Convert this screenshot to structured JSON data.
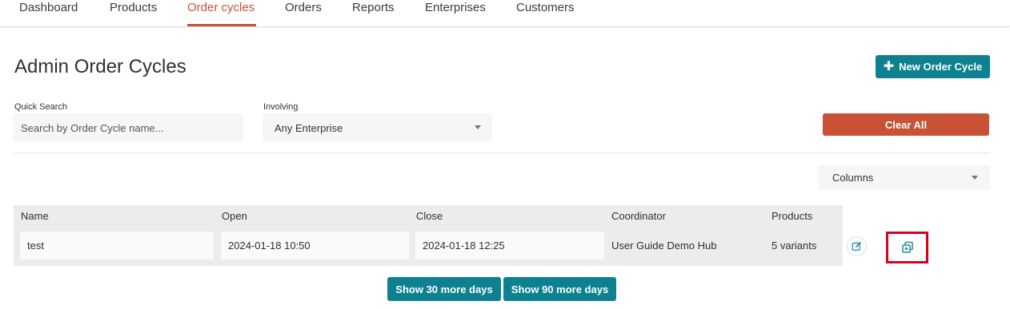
{
  "nav": {
    "tabs": [
      {
        "label": "Dashboard"
      },
      {
        "label": "Products"
      },
      {
        "label": "Order cycles"
      },
      {
        "label": "Orders"
      },
      {
        "label": "Reports"
      },
      {
        "label": "Enterprises"
      },
      {
        "label": "Customers"
      }
    ],
    "active_tab": "Order cycles"
  },
  "header": {
    "title": "Admin Order Cycles",
    "new_button_label": "New Order Cycle",
    "new_button_icon": "plus-icon"
  },
  "filters": {
    "quick_search_label": "Quick Search",
    "quick_search_placeholder": "Search by Order Cycle name...",
    "quick_search_value": "",
    "involving_label": "Involving",
    "involving_value": "Any Enterprise",
    "clear_all_label": "Clear All",
    "columns_label": "Columns"
  },
  "table": {
    "headers": [
      "Name",
      "Open",
      "Close",
      "Coordinator",
      "Products"
    ],
    "rows": [
      {
        "name": "test",
        "open": "2024-01-18 10:50",
        "close": "2024-01-18 12:25",
        "coordinator": "User Guide Demo Hub",
        "products": "5 variants",
        "actions": [
          "edit-icon",
          "clone-icon"
        ]
      }
    ]
  },
  "footer": {
    "show_30_label": "Show 30 more days",
    "show_90_label": "Show 90 more days"
  },
  "colors": {
    "primary_teal": "#0e8190",
    "accent_orange": "#c85136",
    "highlight_red": "#d6001c"
  }
}
